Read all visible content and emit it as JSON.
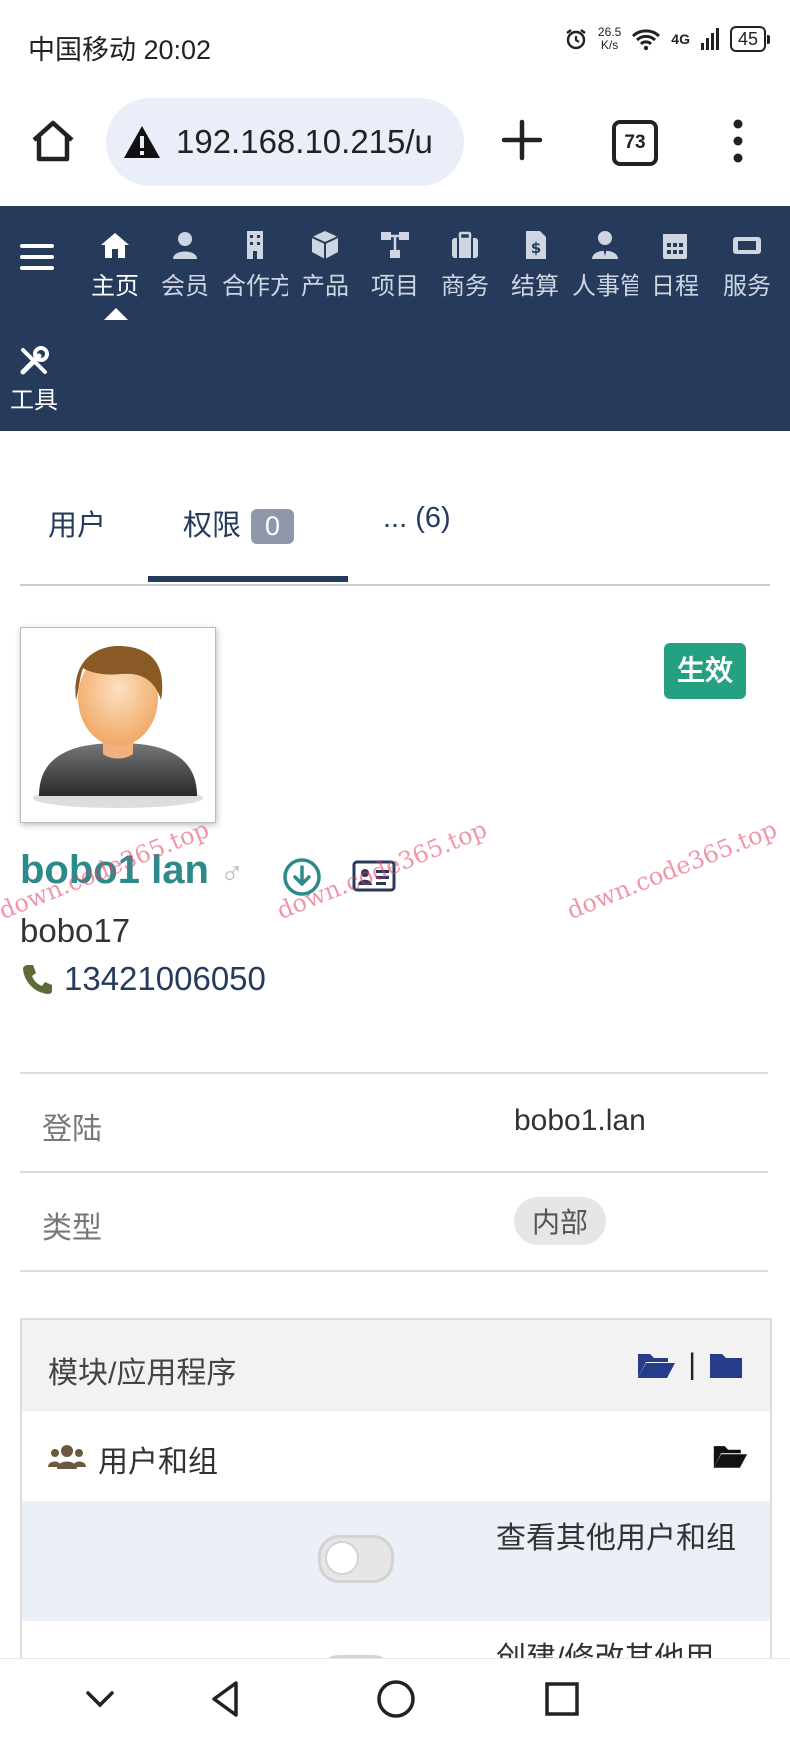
{
  "status_bar": {
    "carrier_time": "中国移动 20:02",
    "speed_value": "26.5",
    "speed_unit": "K/s",
    "network": "4G",
    "battery": "45"
  },
  "browser": {
    "url": "192.168.10.215/u",
    "tab_count": "73"
  },
  "nav": {
    "items": [
      {
        "label": "主页",
        "icon": "home-icon"
      },
      {
        "label": "会员",
        "icon": "user-icon"
      },
      {
        "label": "合作方",
        "icon": "building-icon"
      },
      {
        "label": "产品",
        "icon": "cube-icon"
      },
      {
        "label": "项目",
        "icon": "sitemap-icon"
      },
      {
        "label": "商务",
        "icon": "briefcase-icon"
      },
      {
        "label": "结算",
        "icon": "invoice-icon"
      },
      {
        "label": "人事管理",
        "icon": "user-tie-icon"
      },
      {
        "label": "日程",
        "icon": "calendar-icon"
      },
      {
        "label": "服务",
        "icon": "ticket-icon"
      }
    ],
    "tools_label": "工具"
  },
  "tabs": {
    "user": "用户",
    "perm": "权限",
    "perm_badge": "0",
    "more": "... (6)"
  },
  "profile": {
    "status": "生效",
    "name": "bobo1 lan",
    "gender_symbol": "♂",
    "login": "bobo17",
    "phone": "13421006050"
  },
  "watermark": "down.code365.top",
  "info": {
    "login_label": "登陆",
    "login_value": "bobo1.lan",
    "type_label": "类型",
    "type_value": "内部"
  },
  "permissions": {
    "header": "模块/应用程序",
    "header_separator": "|",
    "group_label": "用户和组",
    "items": [
      {
        "label": "查看其他用户和组"
      },
      {
        "label": "创建/修改其他用"
      }
    ]
  },
  "colors": {
    "nav_bg": "#263b5c",
    "status_active": "#25a182",
    "name_color": "#2d8a8a"
  }
}
